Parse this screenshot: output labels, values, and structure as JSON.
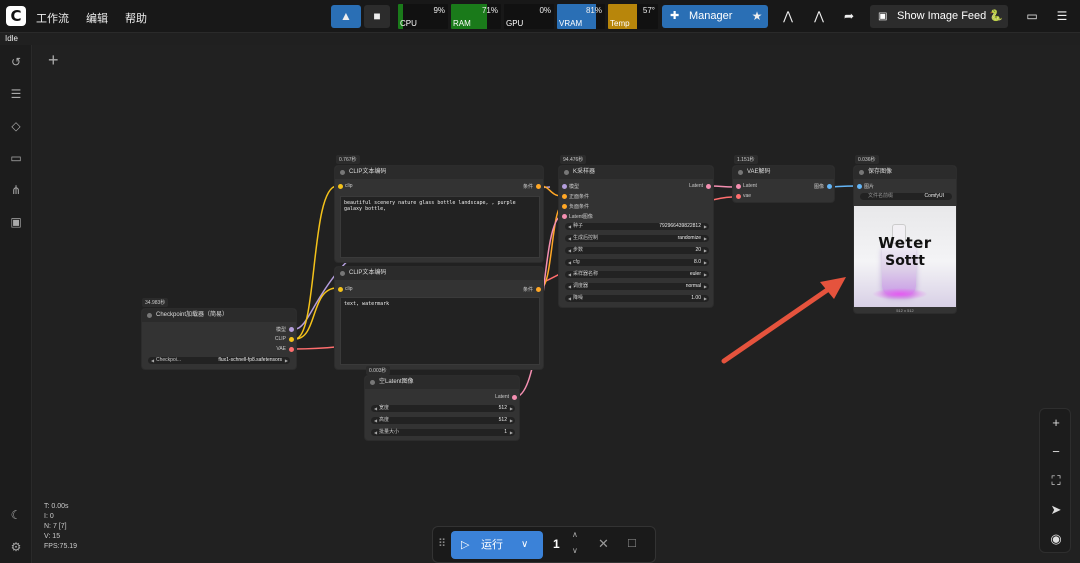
{
  "menu": {
    "workflow": "工作流",
    "edit": "编辑",
    "help": "帮助"
  },
  "status": "Idle",
  "monitors": [
    {
      "name": "CPU",
      "value": "9%",
      "fill": 0.09,
      "color": "#1a7a1a"
    },
    {
      "name": "RAM",
      "value": "71%",
      "fill": 0.71,
      "color": "#1a7a1a"
    },
    {
      "name": "GPU",
      "value": "0%",
      "fill": 0.0,
      "color": "#1a7a1a"
    },
    {
      "name": "VRAM",
      "value": "81%",
      "fill": 0.81,
      "color": "#2a6fb5"
    },
    {
      "name": "Temp",
      "value": "57°",
      "fill": 0.57,
      "color": "#b8860b"
    }
  ],
  "toolbar": {
    "manager": "Manager",
    "show_feed": "Show Image Feed 🐍"
  },
  "nodes": {
    "checkpoint": {
      "timing": "34.983秒",
      "title": "Checkpoint加载器（简易）",
      "out_model": "模型",
      "out_clip": "CLIP",
      "out_vae": "VAE",
      "widget_label": "Checkpoi...",
      "widget_value": "flux1-schnell-fp8.safetensors"
    },
    "clip1": {
      "timing": "0.767秒",
      "title": "CLIP文本编码",
      "in_clip": "clip",
      "out": "条件",
      "text": "beautiful scenery nature glass bottle landscape, , purple galaxy bottle,"
    },
    "clip2": {
      "title": "CLIP文本编码",
      "in_clip": "clip",
      "out": "条件",
      "text": "text, watermark"
    },
    "ksampler": {
      "timing": "94.476秒",
      "title": "K采样器",
      "in_model": "模型",
      "in_pos": "正面条件",
      "in_neg": "负面条件",
      "in_latent": "Latent图像",
      "out": "Latent",
      "widgets": [
        {
          "label": "种子",
          "value": "792966439822812"
        },
        {
          "label": "生成后控制",
          "value": "randomize"
        },
        {
          "label": "步数",
          "value": "20"
        },
        {
          "label": "cfg",
          "value": "8.0"
        },
        {
          "label": "采样器名称",
          "value": "euler"
        },
        {
          "label": "调度器",
          "value": "normal"
        },
        {
          "label": "降噪",
          "value": "1.00"
        }
      ]
    },
    "vae": {
      "timing": "1.151秒",
      "title": "VAE解码",
      "in_latent": "Latent",
      "in_vae": "vae",
      "out": "图像"
    },
    "save": {
      "timing": "0.036秒",
      "title": "保存图像",
      "in_image": "图片",
      "prefix_label": "文件名前缀",
      "prefix_value": "ComfyUI",
      "image_text1": "Weter",
      "image_text2": "Sottt",
      "size": "512 x 512"
    },
    "latent": {
      "timing": "0.003秒",
      "title": "空Latent图像",
      "out": "Latent",
      "widgets": [
        {
          "label": "宽度",
          "value": "512"
        },
        {
          "label": "高度",
          "value": "512"
        },
        {
          "label": "批量大小",
          "value": "1"
        }
      ]
    }
  },
  "stats": {
    "t": "T: 0.00s",
    "i": "I: 0",
    "n": "N: 7 [7]",
    "v": "V: 15",
    "fps": "FPS:75.19"
  },
  "run": {
    "label": "运行",
    "count": "1"
  }
}
